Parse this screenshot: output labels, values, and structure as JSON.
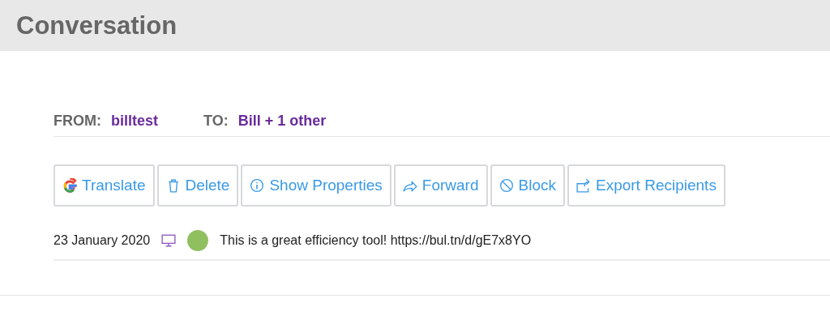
{
  "header": {
    "title": "Conversation"
  },
  "addresses": {
    "from_label": "FROM:",
    "from": "billtest",
    "to_label": "TO:",
    "to": "Bill + 1 other"
  },
  "actions": [
    {
      "kind": "google",
      "label": "Translate"
    },
    {
      "kind": "trash",
      "label": "Delete"
    },
    {
      "kind": "info",
      "label": "Show Properties"
    },
    {
      "kind": "forward",
      "label": "Forward"
    },
    {
      "kind": "block",
      "label": "Block"
    },
    {
      "kind": "export",
      "label": "Export Recipients"
    }
  ],
  "messages": [
    {
      "date": "23 January 2020",
      "color": "#8fbf5f",
      "text": "This is a great efficiency tool! https://bul.tn/d/gE7x8YO"
    }
  ]
}
